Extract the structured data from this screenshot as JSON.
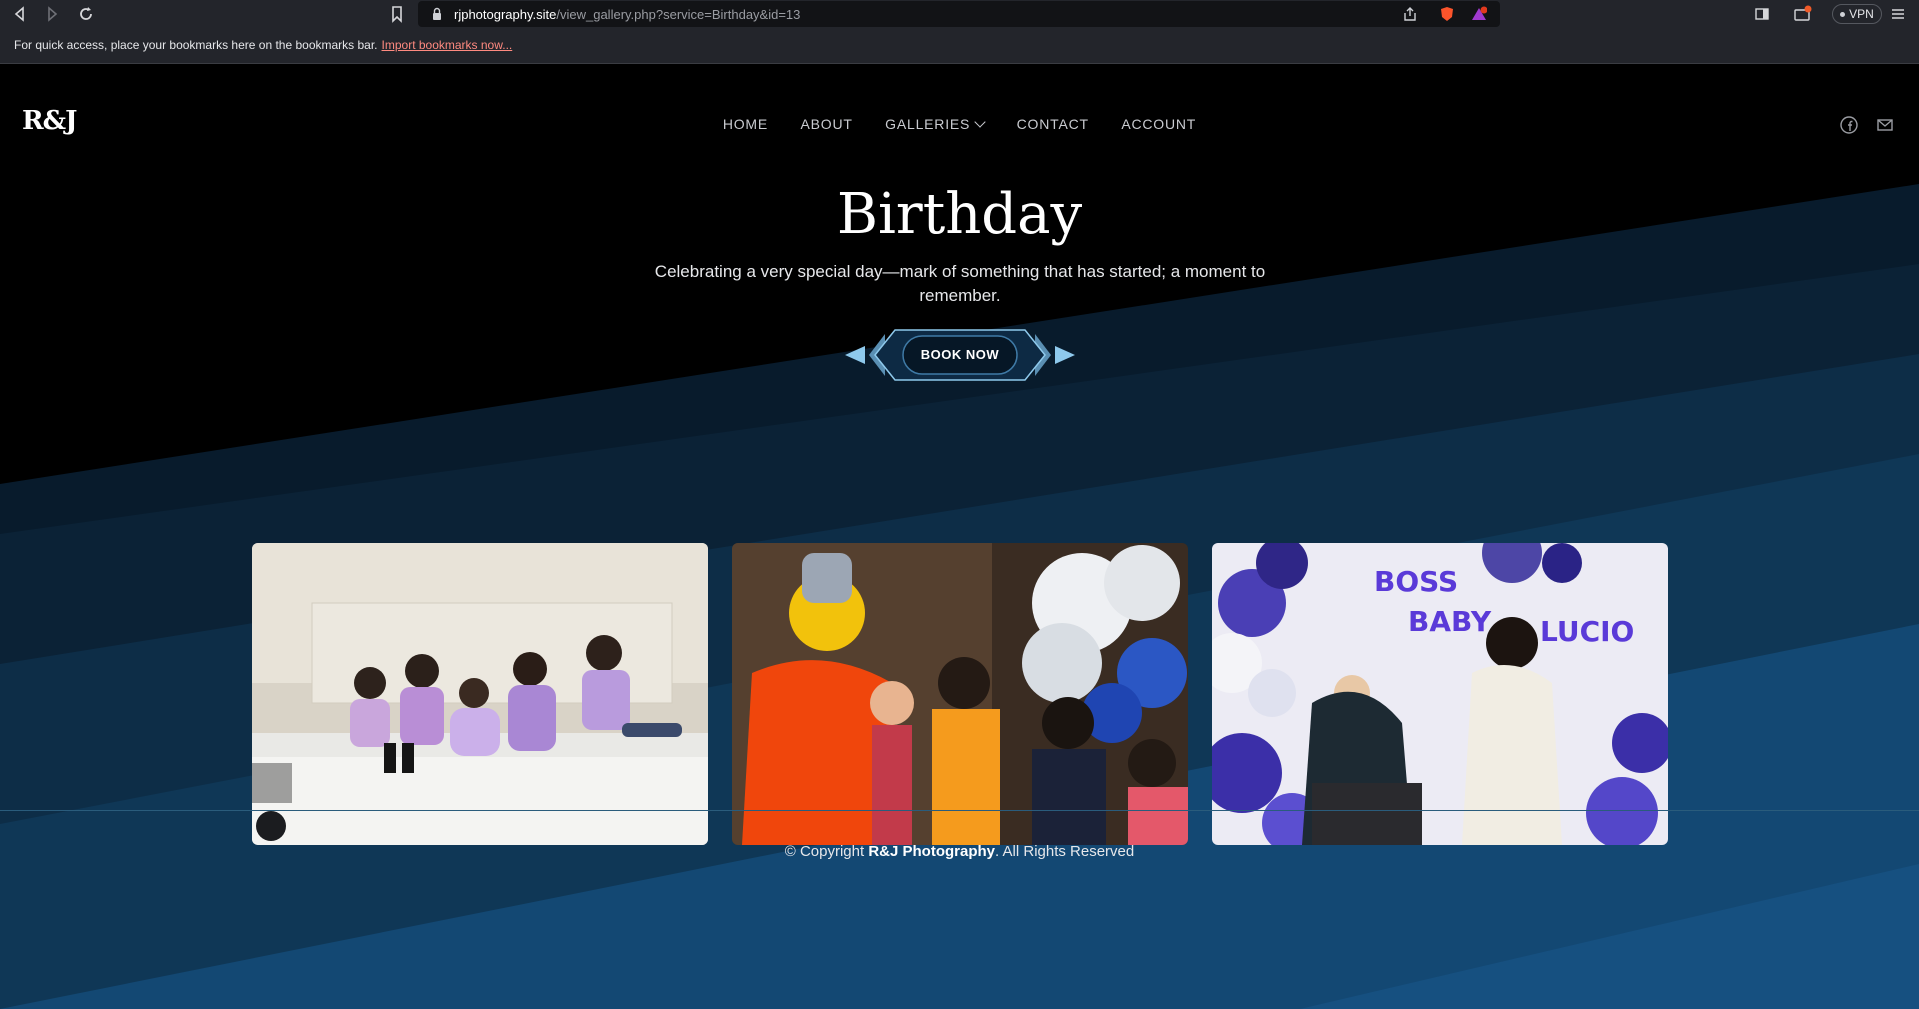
{
  "browser": {
    "url_host": "rjphotography.site",
    "url_path": "/view_gallery.php?service=Birthday&id=13",
    "bookmarks_text": "For quick access, place your bookmarks here on the bookmarks bar.",
    "bookmarks_link": "Import bookmarks now...",
    "vpn_label": "VPN"
  },
  "site": {
    "logo": "R&J",
    "nav": {
      "home": "HOME",
      "about": "ABOUT",
      "galleries": "GALLERIES",
      "contact": "CONTACT",
      "account": "ACCOUNT"
    }
  },
  "hero": {
    "title": "Birthday",
    "subtitle": "Celebrating a very special day—mark of something that has started; a moment to remember.",
    "cta": "BOOK NOW"
  },
  "gallery": {
    "photo3_text": {
      "line1": "BOSS",
      "line2": "BABY",
      "line3": "LUCIO"
    }
  },
  "footer": {
    "prefix": "© Copyright",
    "brand": "R&J Photography",
    "suffix": ". All Rights Reserved"
  },
  "colors": {
    "page_bg": "#000000",
    "band_dark": "#0b2236",
    "band_mid": "#0e3452",
    "band_light": "#134873",
    "accent_arrow": "#8ec9ec"
  }
}
